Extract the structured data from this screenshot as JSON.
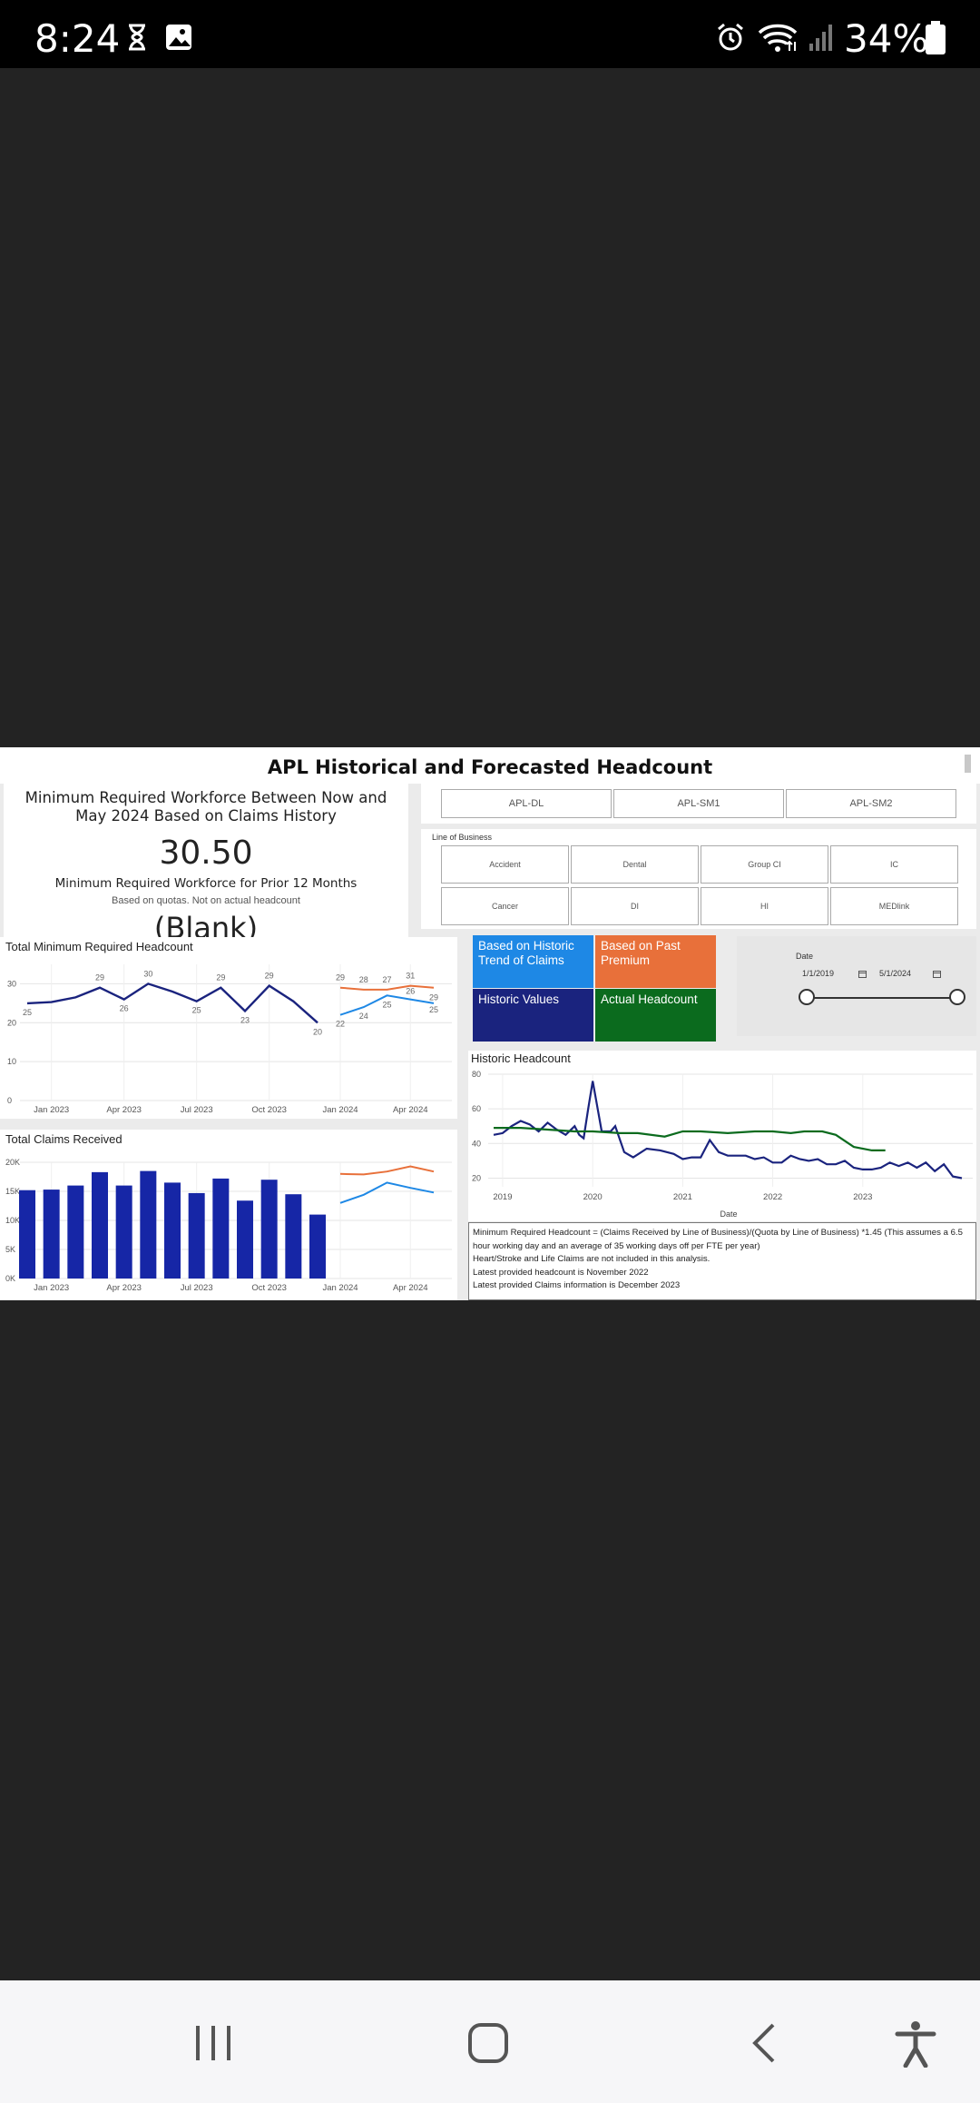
{
  "status": {
    "time": "8:24",
    "battery": "34%"
  },
  "report": {
    "title": "APL Historical and Forecasted Headcount",
    "kpi": {
      "heading": "Minimum Required Workforce Between Now and May 2024 Based on Claims History",
      "value": "30.50",
      "subheading": "Minimum Required Workforce for Prior 12 Months",
      "note": "Based on quotas.  Not on actual headcount",
      "blank": "(Blank)"
    },
    "slicer_buttons": [
      "APL-DL",
      "APL-SM1",
      "APL-SM2"
    ],
    "line_of_business": {
      "label": "Line of Business",
      "options": [
        "Accident",
        "Dental",
        "Group CI",
        "IC",
        "Cancer",
        "DI",
        "HI",
        "MEDlink"
      ]
    },
    "legend_cards": [
      {
        "label": "Based on Historic Trend of Claims",
        "color": "#1e88e5"
      },
      {
        "label": "Based on Past Premium",
        "color": "#e8703a"
      },
      {
        "label": "Historic Values",
        "color": "#1a237e"
      },
      {
        "label": "Actual Headcount",
        "color": "#0b6b1e"
      }
    ],
    "date_slicer": {
      "label": "Date",
      "start": "1/1/2019",
      "end": "5/1/2024",
      "start_value": 0,
      "end_value": 1
    },
    "note_lines": [
      "Minimum Required Headcount = (Claims  Received by Line of Business)/(Quota by Line of Business) *1.45    (This assumes a 6.5 hour working day and an average of 35 working days off per FTE per year)",
      "Heart/Stroke and Life Claims are not included in this analysis.",
      "Latest provided headcount is November 2022",
      "Latest provided Claims information is December 2023"
    ]
  },
  "chart_data": [
    {
      "type": "line",
      "title": "Total Minimum Required Headcount",
      "categories": [
        "Dec 2022",
        "Jan 2023",
        "Feb 2023",
        "Mar 2023",
        "Apr 2023",
        "May 2023",
        "Jun 2023",
        "Jul 2023",
        "Aug 2023",
        "Sep 2023",
        "Oct 2023",
        "Nov 2023",
        "Dec 2023",
        "Jan 2024",
        "Feb 2024",
        "Mar 2024",
        "Apr 2024",
        "May 2024"
      ],
      "xticks": [
        "Jan 2023",
        "Apr 2023",
        "Jul 2023",
        "Oct 2023",
        "Jan 2024",
        "Apr 2024"
      ],
      "ylim": [
        0,
        35
      ],
      "yticks": [
        0,
        10,
        20,
        30
      ],
      "series": [
        {
          "name": "Historic Values",
          "color": "#1a237e",
          "values": [
            25,
            25.3,
            26.5,
            29,
            26,
            30,
            28,
            25.5,
            29,
            23,
            29.5,
            25.5,
            20,
            null,
            null,
            null,
            null,
            null
          ],
          "labels": [
            25,
            null,
            null,
            29,
            26,
            30,
            null,
            25,
            29,
            23,
            29,
            null,
            20,
            null,
            null,
            null,
            null,
            null
          ]
        },
        {
          "name": "Based on Past Premium",
          "color": "#e8703a",
          "values": [
            null,
            null,
            null,
            null,
            null,
            null,
            null,
            null,
            null,
            null,
            null,
            null,
            null,
            29,
            28.5,
            28.5,
            29.5,
            29
          ],
          "labels": [
            null,
            null,
            null,
            null,
            null,
            null,
            null,
            null,
            null,
            null,
            null,
            null,
            null,
            29,
            28,
            27,
            31,
            29
          ]
        },
        {
          "name": "Based on Historic Trend of Claims",
          "color": "#1e88e5",
          "values": [
            null,
            null,
            null,
            null,
            null,
            null,
            null,
            null,
            null,
            null,
            null,
            null,
            null,
            22,
            24,
            27,
            26,
            25
          ],
          "labels": [
            null,
            null,
            null,
            null,
            null,
            null,
            null,
            null,
            null,
            null,
            null,
            null,
            null,
            22,
            24,
            25,
            26,
            25
          ]
        }
      ]
    },
    {
      "type": "bar",
      "title": "Total Claims Received",
      "categories": [
        "Dec 2022",
        "Jan 2023",
        "Feb 2023",
        "Mar 2023",
        "Apr 2023",
        "May 2023",
        "Jun 2023",
        "Jul 2023",
        "Aug 2023",
        "Sep 2023",
        "Oct 2023",
        "Nov 2023",
        "Dec 2023",
        "Jan 2024",
        "Feb 2024",
        "Mar 2024",
        "Apr 2024",
        "May 2024"
      ],
      "xticks": [
        "Jan 2023",
        "Apr 2023",
        "Jul 2023",
        "Oct 2023",
        "Jan 2024",
        "Apr 2024"
      ],
      "ylim": [
        0,
        20000
      ],
      "yticks": [
        "0K",
        "5K",
        "10K",
        "15K",
        "20K"
      ],
      "series": [
        {
          "name": "Historic Values",
          "color": "#1a237e",
          "values": [
            15200,
            15300,
            16000,
            18300,
            16000,
            18500,
            16500,
            14700,
            17200,
            13400,
            17000,
            14500,
            11000,
            null,
            null,
            null,
            null,
            null
          ]
        },
        {
          "name": "Based on Past Premium",
          "color": "#e8703a",
          "values": [
            null,
            null,
            null,
            null,
            null,
            null,
            null,
            null,
            null,
            null,
            null,
            null,
            null,
            18000,
            17900,
            18400,
            19300,
            18400
          ]
        },
        {
          "name": "Based on Historic Trend of Claims",
          "color": "#1e88e5",
          "values": [
            null,
            null,
            null,
            null,
            null,
            null,
            null,
            null,
            null,
            null,
            null,
            null,
            null,
            13000,
            14400,
            16500,
            15600,
            14800
          ]
        }
      ]
    },
    {
      "type": "line",
      "title": "Historic Headcount",
      "xlabel": "Date",
      "xticks": [
        "2019",
        "2020",
        "2021",
        "2022",
        "2023"
      ],
      "xlim": [
        2018.9,
        2024.1
      ],
      "ylim": [
        15,
        80
      ],
      "yticks": [
        20,
        40,
        60,
        80
      ],
      "series": [
        {
          "name": "Historic Values",
          "color": "#1a237e",
          "x": [
            2018.9,
            2019.0,
            2019.1,
            2019.2,
            2019.3,
            2019.4,
            2019.5,
            2019.6,
            2019.7,
            2019.8,
            2019.85,
            2019.9,
            2019.95,
            2020.0,
            2020.1,
            2020.2,
            2020.25,
            2020.35,
            2020.45,
            2020.6,
            2020.75,
            2020.9,
            2021.0,
            2021.1,
            2021.2,
            2021.3,
            2021.4,
            2021.5,
            2021.6,
            2021.7,
            2021.8,
            2021.9,
            2022.0,
            2022.1,
            2022.2,
            2022.3,
            2022.4,
            2022.5,
            2022.6,
            2022.7,
            2022.8,
            2022.9,
            2023.0,
            2023.1,
            2023.2,
            2023.3,
            2023.4,
            2023.5,
            2023.6,
            2023.7,
            2023.8,
            2023.9,
            2024.0,
            2024.1
          ],
          "values": [
            45,
            46,
            50,
            53,
            51,
            47,
            52,
            48,
            45,
            50,
            45,
            43,
            60,
            76,
            47,
            47,
            50,
            35,
            32,
            37,
            36,
            34,
            31,
            32,
            32,
            42,
            35,
            33,
            33,
            33,
            31,
            32,
            29,
            29,
            33,
            31,
            30,
            31,
            28,
            28,
            30,
            26,
            25,
            25,
            26,
            29,
            27,
            29,
            26,
            29,
            24,
            28,
            21,
            20
          ]
        },
        {
          "name": "Actual Headcount",
          "color": "#0b6b1e",
          "x": [
            2018.9,
            2019.2,
            2019.5,
            2019.8,
            2020.0,
            2020.3,
            2020.5,
            2020.8,
            2021.0,
            2021.2,
            2021.5,
            2021.8,
            2022.0,
            2022.2,
            2022.35,
            2022.45,
            2022.55,
            2022.7,
            2022.9,
            2023.1,
            2023.25
          ],
          "values": [
            49,
            49,
            48,
            47,
            47,
            46,
            46,
            44,
            47,
            47,
            46,
            47,
            47,
            46,
            47,
            47,
            47,
            45,
            38,
            36,
            36
          ]
        }
      ]
    }
  ]
}
